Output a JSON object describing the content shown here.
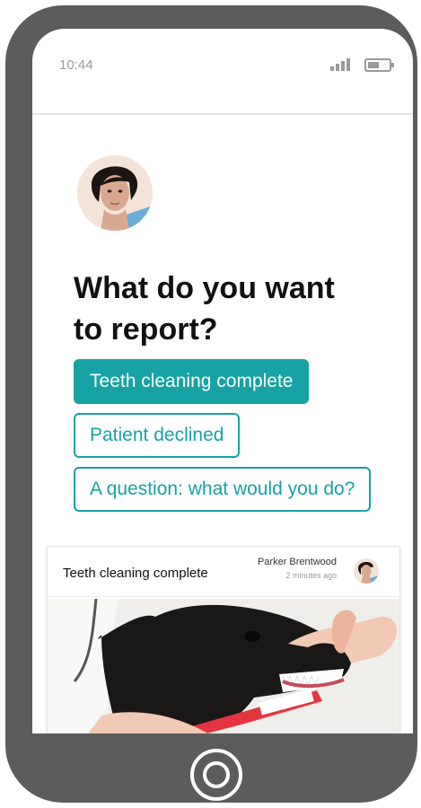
{
  "status_bar": {
    "time": "10:44"
  },
  "prompt": {
    "title_line1": "What do you want",
    "title_line2": "to report?"
  },
  "options": [
    {
      "label": "Teeth cleaning complete",
      "selected": true
    },
    {
      "label": "Patient declined",
      "selected": false
    },
    {
      "label": "A question: what would you do?",
      "selected": false
    }
  ],
  "card": {
    "title": "Teeth cleaning complete",
    "author": "Parker Brentwood",
    "time": "2 minutes ago"
  },
  "colors": {
    "accent": "#17a2a4",
    "phone_frame": "#5c5c5c"
  },
  "icons": [
    "signal-icon",
    "battery-icon",
    "home-button-icon"
  ]
}
